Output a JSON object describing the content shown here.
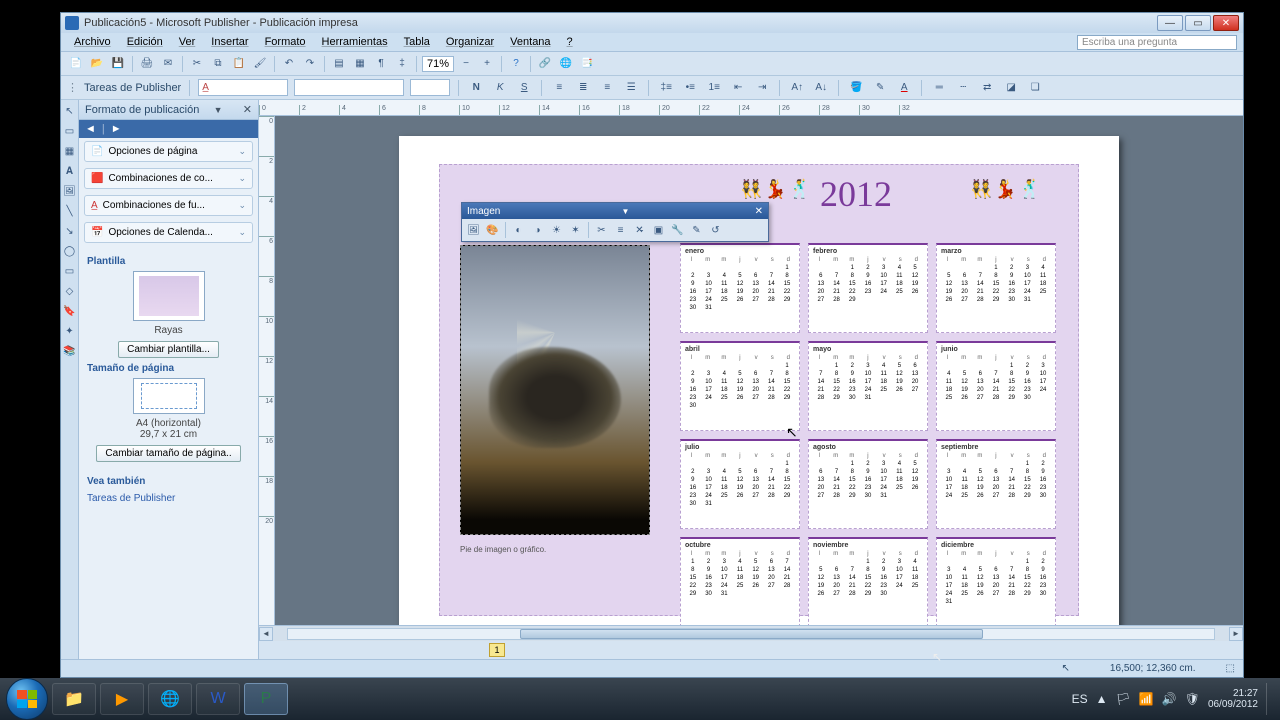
{
  "titlebar": {
    "text": "Publicación5 - Microsoft Publisher - Publicación impresa"
  },
  "menubar": {
    "items": [
      "Archivo",
      "Edición",
      "Ver",
      "Insertar",
      "Formato",
      "Herramientas",
      "Tabla",
      "Organizar",
      "Ventana",
      "?"
    ],
    "askbox": "Escriba una pregunta"
  },
  "toolbar": {
    "zoom": "71%"
  },
  "taskrow": {
    "label": "Tareas de Publisher"
  },
  "taskpane": {
    "title": "Formato de publicación",
    "sections": [
      "Opciones de página",
      "Combinaciones de co...",
      "Combinaciones de fu...",
      "Opciones de Calenda..."
    ],
    "plantilla_label": "Plantilla",
    "plantilla_name": "Rayas",
    "cambiar_plantilla": "Cambiar plantilla...",
    "tamano_label": "Tamaño de página",
    "tamano_name": "A4 (horizontal)",
    "tamano_dim": "29,7 x 21 cm",
    "cambiar_tamano": "Cambiar tamaño de página..",
    "vea_label": "Vea también",
    "vea_link": "Tareas de Publisher"
  },
  "ruler_h": [
    "0",
    "2",
    "4",
    "6",
    "8",
    "10",
    "12",
    "14",
    "16",
    "18",
    "20",
    "22",
    "24",
    "26",
    "28",
    "30",
    "32"
  ],
  "ruler_v": [
    "0",
    "2",
    "4",
    "6",
    "8",
    "10",
    "12",
    "14",
    "16",
    "18",
    "20"
  ],
  "float_toolbar": {
    "title": "Imagen"
  },
  "calendar": {
    "year": "2012",
    "caption": "Pie de imagen o gráfico.",
    "dow": [
      "l",
      "m",
      "m",
      "j",
      "v",
      "s",
      "d"
    ],
    "months": [
      {
        "name": "enero",
        "start": 6,
        "len": 31
      },
      {
        "name": "febrero",
        "start": 2,
        "len": 29
      },
      {
        "name": "marzo",
        "start": 3,
        "len": 31
      },
      {
        "name": "abril",
        "start": 6,
        "len": 30
      },
      {
        "name": "mayo",
        "start": 1,
        "len": 31
      },
      {
        "name": "junio",
        "start": 4,
        "len": 30
      },
      {
        "name": "julio",
        "start": 6,
        "len": 31
      },
      {
        "name": "agosto",
        "start": 2,
        "len": 31
      },
      {
        "name": "septiembre",
        "start": 5,
        "len": 30
      },
      {
        "name": "octubre",
        "start": 0,
        "len": 31
      },
      {
        "name": "noviembre",
        "start": 3,
        "len": 30
      },
      {
        "name": "diciembre",
        "start": 5,
        "len": 31
      }
    ]
  },
  "pagetab": "1",
  "statusbar": {
    "coord": "16,500; 12,360 cm."
  },
  "wintaskbar": {
    "lang": "ES",
    "time": "21:27",
    "date": "06/09/2012"
  }
}
